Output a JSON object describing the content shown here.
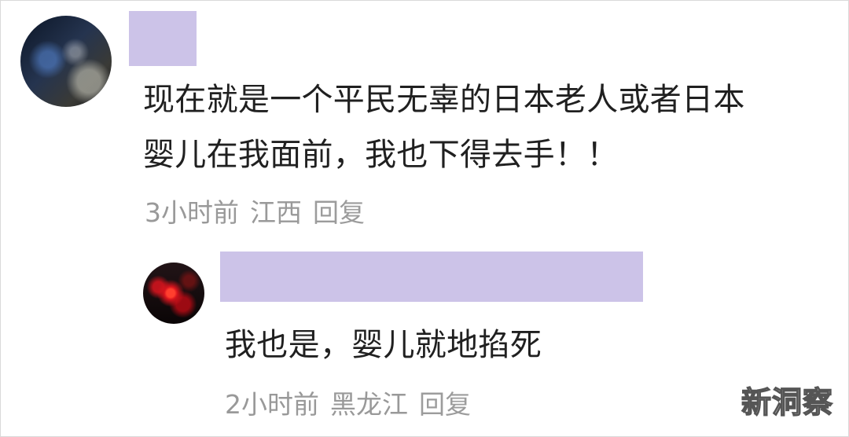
{
  "comments": [
    {
      "text_line_1": "现在就是一个平民无辜的日本老人或者日本",
      "text_line_2": "婴儿在我面前，我也下得去手！！",
      "time": "3小时前",
      "location": "江西",
      "reply_label": "回复"
    },
    {
      "text": "我也是，婴儿就地掐死",
      "time": "2小时前",
      "location": "黑龙江",
      "reply_label": "回复"
    }
  ],
  "watermark": "新洞察",
  "colors": {
    "name_redaction": "#ccc3e8",
    "meta_text": "#999999",
    "body_text": "#202020"
  }
}
